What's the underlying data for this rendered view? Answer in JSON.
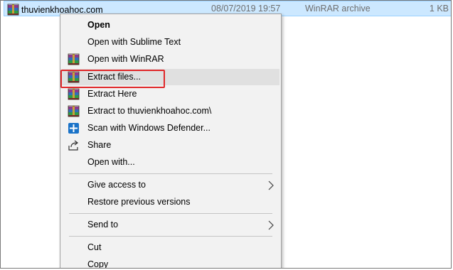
{
  "file": {
    "name": "thuvienkhoahoc.com",
    "date": "08/07/2019 19:57",
    "type": "WinRAR archive",
    "size": "1 KB",
    "icon": "winrar-archive-icon"
  },
  "menu": {
    "items": [
      {
        "label": "Open",
        "icon": ""
      },
      {
        "label": "Open with Sublime Text",
        "icon": ""
      },
      {
        "label": "Open with WinRAR",
        "icon": "winrar-icon"
      },
      {
        "label": "Extract files...",
        "icon": "winrar-icon"
      },
      {
        "label": "Extract Here",
        "icon": "winrar-icon"
      },
      {
        "label": "Extract to thuvienkhoahoc.com\\",
        "icon": "winrar-icon"
      },
      {
        "label": "Scan with Windows Defender...",
        "icon": "defender-shield-icon"
      },
      {
        "label": "Share",
        "icon": "share-icon"
      },
      {
        "label": "Open with...",
        "icon": ""
      },
      {
        "label": "Give access to",
        "icon": "",
        "submenu": true
      },
      {
        "label": "Restore previous versions",
        "icon": ""
      },
      {
        "label": "Send to",
        "icon": "",
        "submenu": true
      },
      {
        "label": "Cut",
        "icon": ""
      },
      {
        "label": "Copy",
        "icon": ""
      }
    ],
    "highlighted": "Extract files..."
  },
  "colors": {
    "selection": "#cce8ff",
    "highlight_box": "#e0282a",
    "menu_bg": "#f2f2f2",
    "defender_blue": "#1a73c8"
  }
}
